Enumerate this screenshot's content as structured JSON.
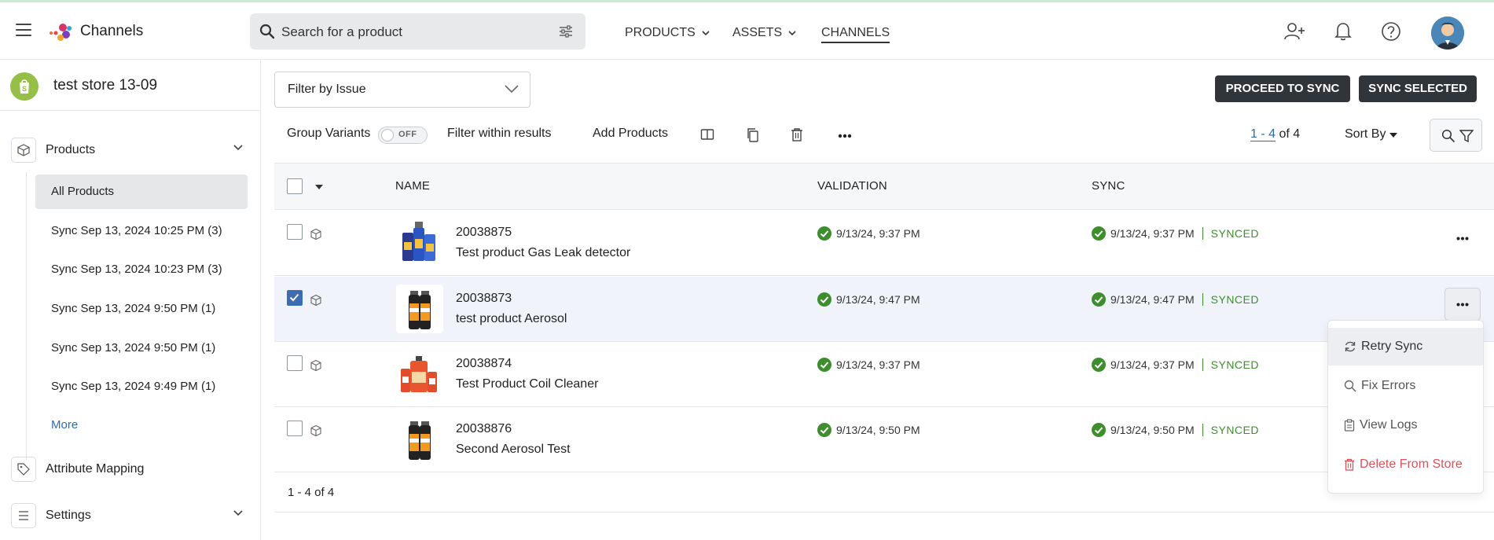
{
  "app": {
    "brand": "Channels"
  },
  "search": {
    "placeholder": "Search for a product"
  },
  "nav": {
    "products": "PRODUCTS",
    "assets": "ASSETS",
    "channels": "CHANNELS"
  },
  "store": {
    "name": "test store 13-09"
  },
  "sidebar": {
    "products_label": "Products",
    "items": [
      {
        "label": "All Products"
      },
      {
        "label": "Sync Sep 13, 2024 10:25 PM (3)"
      },
      {
        "label": "Sync Sep 13, 2024 10:23 PM (3)"
      },
      {
        "label": "Sync Sep 13, 2024 9:50 PM (1)"
      },
      {
        "label": "Sync Sep 13, 2024 9:50 PM (1)"
      },
      {
        "label": "Sync Sep 13, 2024 9:49 PM (1)"
      }
    ],
    "more_label": "More",
    "attribute_mapping_label": "Attribute Mapping",
    "settings_label": "Settings"
  },
  "filter": {
    "placeholder": "Filter by Issue"
  },
  "actions": {
    "proceed": "PROCEED TO SYNC",
    "sync_selected": "SYNC SELECTED"
  },
  "toolbar": {
    "group_variants": "Group Variants",
    "toggle_state": "OFF",
    "filter_within": "Filter within results",
    "add_products": "Add Products",
    "pager_range": "1 - 4",
    "pager_total": "of 4",
    "sort_by": "Sort By"
  },
  "table": {
    "headers": {
      "name": "NAME",
      "validation": "VALIDATION",
      "sync": "SYNC"
    },
    "rows": [
      {
        "sku": "20038875",
        "name": "Test product Gas Leak detector",
        "validation": "9/13/24, 9:37 PM",
        "sync": "9/13/24, 9:37 PM",
        "status": "SYNCED",
        "checked": false
      },
      {
        "sku": "20038873",
        "name": "test product Aerosol",
        "validation": "9/13/24, 9:47 PM",
        "sync": "9/13/24, 9:47 PM",
        "status": "SYNCED",
        "checked": true
      },
      {
        "sku": "20038874",
        "name": "Test Product Coil Cleaner",
        "validation": "9/13/24, 9:37 PM",
        "sync": "9/13/24, 9:37 PM",
        "status": "SYNCED",
        "checked": false
      },
      {
        "sku": "20038876",
        "name": "Second Aerosol Test",
        "validation": "9/13/24, 9:50 PM",
        "sync": "9/13/24, 9:50 PM",
        "status": "SYNCED",
        "checked": false
      }
    ],
    "footer": "1 - 4 of 4"
  },
  "row_menu": {
    "retry": "Retry Sync",
    "fix": "Fix Errors",
    "logs": "View Logs",
    "delete": "Delete From Store"
  },
  "colors": {
    "accent": "#2d6bb2",
    "success": "#3e8e2d",
    "danger": "#d9535b",
    "dark_button": "#30353a",
    "shopify": "#95bf47"
  }
}
